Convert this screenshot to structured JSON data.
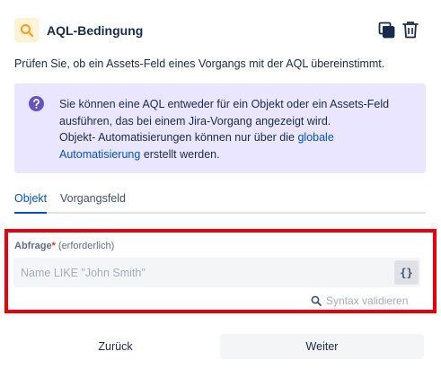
{
  "header": {
    "title": "AQL-Bedingung",
    "icon": "search-icon",
    "accent": "#ff991f",
    "actions": [
      "copy-icon",
      "trash-icon"
    ]
  },
  "description": "Prüfen Sie, ob ein Assets-Feld eines Vorgangs mit der AQL übereinstimmt.",
  "info": {
    "icon": "question-icon",
    "text_line1": "Sie können eine AQL entweder für ein Objekt oder ein Assets-Feld",
    "text_line2": "ausführen, das bei einem Jira-Vorgang angezeigt wird.",
    "text_line3_prefix": "Objekt- Automatisierungen können nur über die",
    "link1": "globale",
    "link2": "Automatisierung",
    "text_line4_suffix": "erstellt werden.",
    "background": "#eae6ff",
    "icon_color": "#6554c0"
  },
  "tabs": [
    {
      "label": "Objekt",
      "active": true
    },
    {
      "label": "Vorgangsfeld",
      "active": false
    }
  ],
  "query": {
    "label": "Abfrage",
    "required_marker": "*",
    "hint": "(erforderlich)",
    "placeholder": "Name LIKE \"John Smith\"",
    "value": "",
    "brace_button": "{}"
  },
  "validate_label": "Syntax validieren",
  "footer": {
    "back_label": "Zurück",
    "next_label": "Weiter"
  },
  "highlight_color": "#e8000a"
}
